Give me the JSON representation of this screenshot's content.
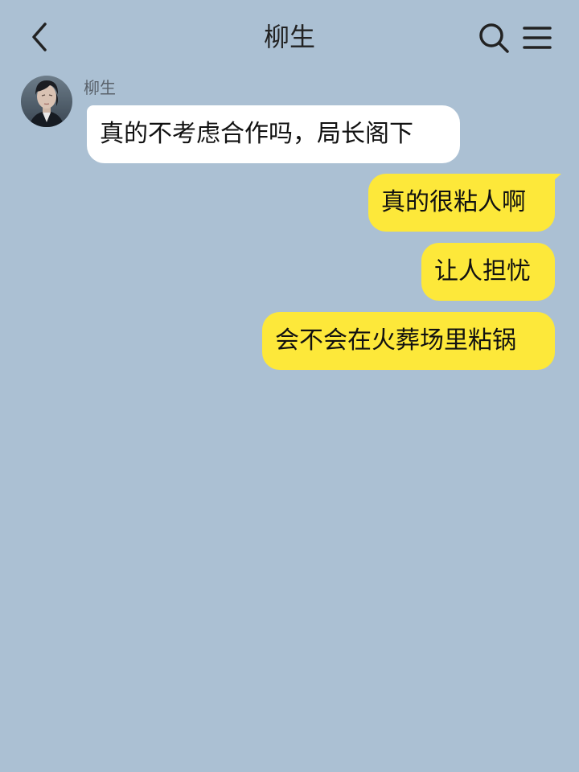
{
  "header": {
    "title": "柳生"
  },
  "icons": {
    "back": "chevron-left-icon",
    "search": "search-icon",
    "menu": "hamburger-menu-icon"
  },
  "colors": {
    "background": "#abc0d3",
    "incoming_bubble": "#ffffff",
    "outgoing_bubble": "#fde83a",
    "text": "#111111"
  },
  "messages": [
    {
      "from": "other",
      "sender_name": "柳生",
      "text": "真的不考虑合作吗，局长阁下"
    },
    {
      "from": "me",
      "text": "真的很粘人啊"
    },
    {
      "from": "me",
      "text": "让人担忧"
    },
    {
      "from": "me",
      "text": "会不会在火葬场里粘锅"
    }
  ]
}
